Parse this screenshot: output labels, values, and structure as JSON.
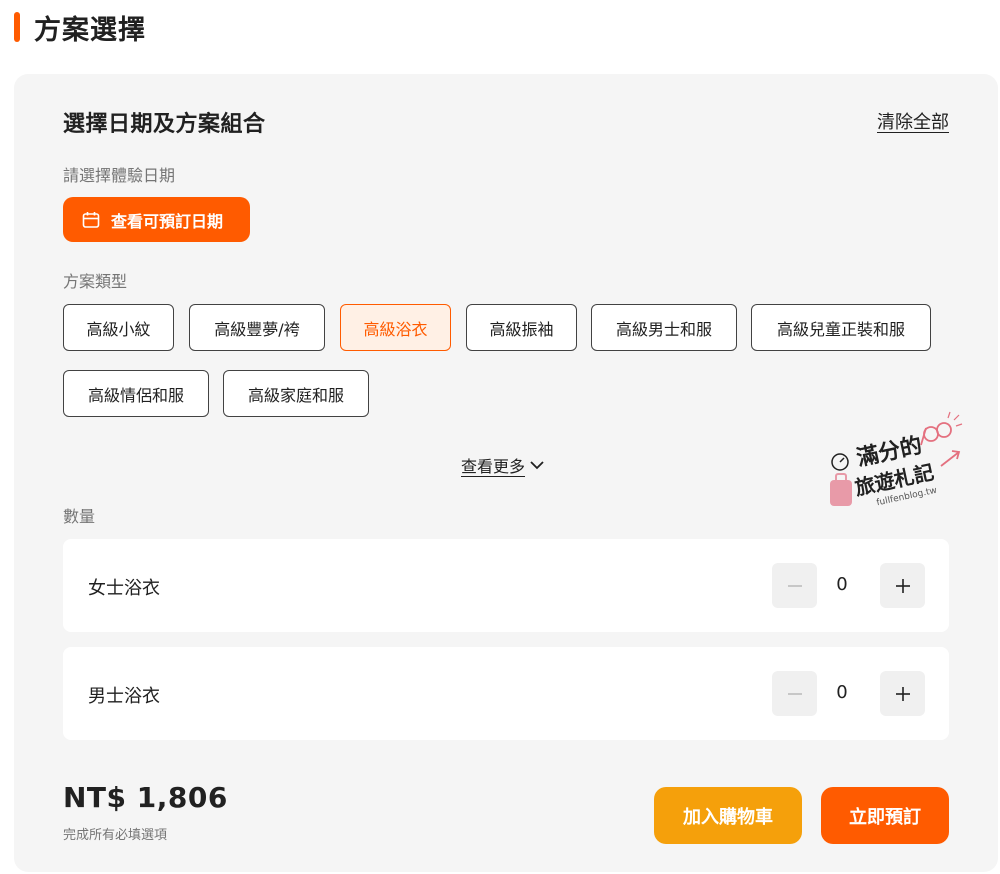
{
  "section": {
    "title": "方案選擇"
  },
  "panel": {
    "title": "選擇日期及方案組合",
    "clear_all": "清除全部",
    "date_label": "請選擇體驗日期",
    "date_button": "查看可預訂日期",
    "type_label": "方案類型",
    "plan_types": [
      {
        "label": "高級小紋",
        "selected": false
      },
      {
        "label": "高級豐夢/袴",
        "selected": false
      },
      {
        "label": "高級浴衣",
        "selected": true
      },
      {
        "label": "高級振袖",
        "selected": false
      },
      {
        "label": "高級男士和服",
        "selected": false
      },
      {
        "label": "高級兒童正裝和服",
        "selected": false
      },
      {
        "label": "高級情侶和服",
        "selected": false
      },
      {
        "label": "高級家庭和服",
        "selected": false
      }
    ],
    "see_more": "查看更多",
    "qty_label": "數量",
    "quantities": [
      {
        "label": "女士浴衣",
        "value": "0"
      },
      {
        "label": "男士浴衣",
        "value": "0"
      }
    ],
    "price": "NT$ 1,806",
    "price_note": "完成所有必填選項",
    "add_to_cart": "加入購物車",
    "book_now": "立即預訂"
  },
  "watermark": {
    "line1": "滿分的",
    "line2": "旅遊札記",
    "url": "fullfenblog.tw"
  },
  "colors": {
    "accent": "#ff5b00",
    "cart": "#f5a00b",
    "panel_bg": "#f5f5f5"
  },
  "icons": {
    "date_button": "calendar-icon",
    "see_more": "chevron-down-icon",
    "minus": "minus-icon",
    "plus": "plus-icon"
  }
}
